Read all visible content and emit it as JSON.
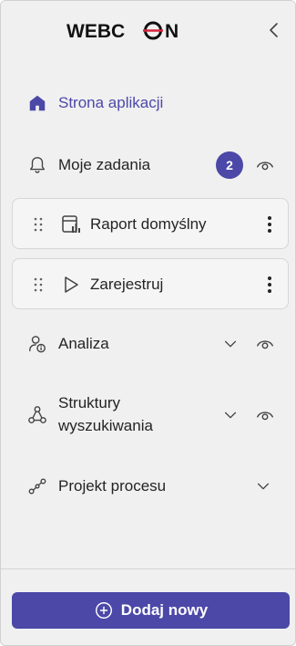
{
  "logo": {
    "text_left": "WEBC",
    "text_right": "N",
    "brand_red": "#d7263d"
  },
  "colors": {
    "accent": "#4b48a8",
    "panel_bg": "#f0f0f0"
  },
  "nav": {
    "home": {
      "label": "Strona aplikacji",
      "icon": "home-icon"
    },
    "tasks": {
      "label": "Moje zadania",
      "badge": "2",
      "icon": "bell-icon"
    },
    "pinned": [
      {
        "label": "Raport domyślny",
        "icon": "report-icon"
      },
      {
        "label": "Zarejestruj",
        "icon": "play-icon"
      }
    ],
    "analysis": {
      "label": "Analiza",
      "icon": "person-info-icon"
    },
    "structures": {
      "label_line1": "Struktury",
      "label_line2": "wyszukiwania",
      "icon": "structure-icon"
    },
    "process": {
      "label": "Projekt procesu",
      "icon": "process-icon"
    }
  },
  "footer": {
    "add_label": "Dodaj nowy",
    "icon": "plus-circle-icon"
  }
}
